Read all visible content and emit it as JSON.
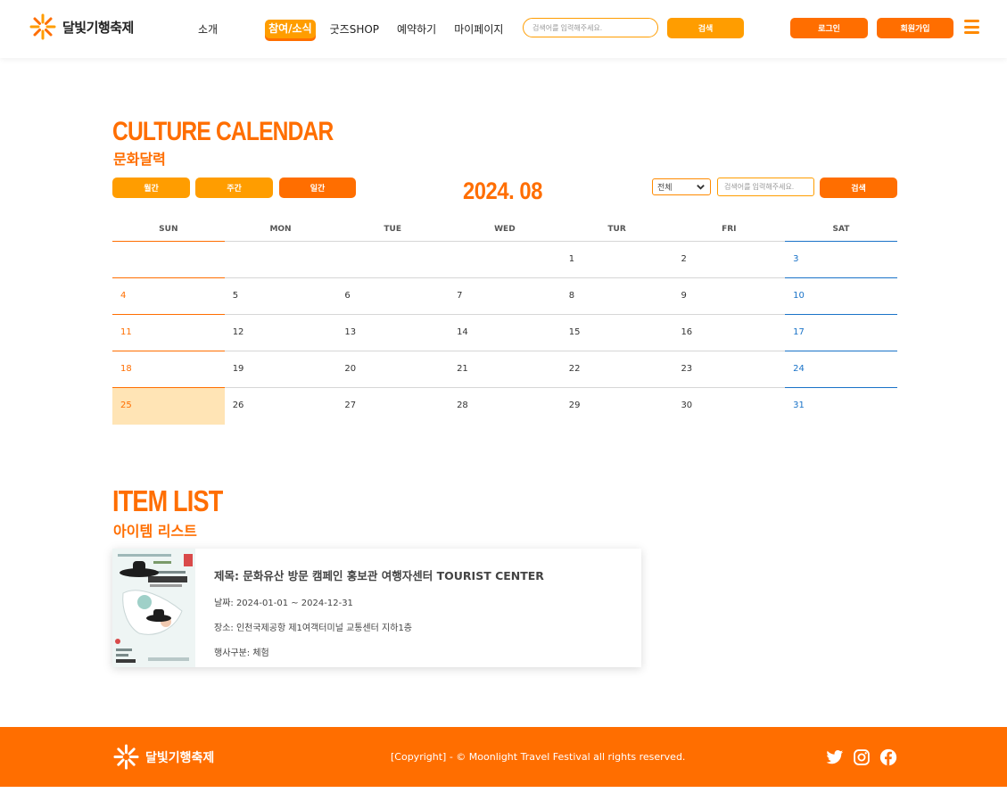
{
  "header": {
    "logo_text": "달빛기행축제",
    "nav": [
      {
        "label": "소개",
        "active": false
      },
      {
        "label": "참여/소식",
        "active": true
      },
      {
        "label": "굿즈SHOP",
        "active": false
      },
      {
        "label": "예약하기",
        "active": false
      },
      {
        "label": "마이페이지",
        "active": false
      }
    ],
    "search_placeholder": "검색어를 입력해주세요.",
    "search_button": "검색",
    "login_button": "로그인",
    "signup_button": "회원가입"
  },
  "calendar_section": {
    "title_en": "CULTURE CALENDAR",
    "title_ko": "문화달력",
    "view_buttons": [
      "월간",
      "주간",
      "일간"
    ],
    "month": "2024. 08",
    "filter_selected": "전체",
    "search_placeholder": "검색어를 입력해주세요.",
    "search_button": "검색",
    "weekdays": [
      "SUN",
      "MON",
      "TUE",
      "WED",
      "TUR",
      "FRI",
      "SAT"
    ],
    "weeks": [
      [
        "",
        "",
        "",
        "",
        "1",
        "2",
        "3"
      ],
      [
        "4",
        "5",
        "6",
        "7",
        "8",
        "9",
        "10"
      ],
      [
        "11",
        "12",
        "13",
        "14",
        "15",
        "16",
        "17"
      ],
      [
        "18",
        "19",
        "20",
        "21",
        "22",
        "23",
        "24"
      ],
      [
        "25",
        "26",
        "27",
        "28",
        "29",
        "30",
        "31"
      ]
    ],
    "today": "25"
  },
  "item_section": {
    "title_en": "ITEM LIST",
    "title_ko": "아이템 리스트",
    "items": [
      {
        "title": "제목: 문화유산 방문 캠페인 홍보관 여행자센터 TOURIST CENTER",
        "date": "날짜: 2024-01-01 ~ 2024-12-31",
        "place": "장소: 인천국제공항 제1여객터미널 교통센터 지하1층",
        "category": "행사구분: 체험"
      }
    ]
  },
  "footer": {
    "logo_text": "달빛기행축제",
    "copyright": "[Copyright] - © Moonlight Travel Festival all rights reserved."
  },
  "colors": {
    "brand_orange": "#ff6e00",
    "brand_yellow": "#ff9d00",
    "saturday_blue": "#1a73c8",
    "today_bg": "#ffe4b5"
  },
  "icons": [
    "sun-logo-icon",
    "chevron-down-icon",
    "hamburger-menu-icon",
    "twitter-icon",
    "instagram-icon",
    "facebook-icon"
  ]
}
